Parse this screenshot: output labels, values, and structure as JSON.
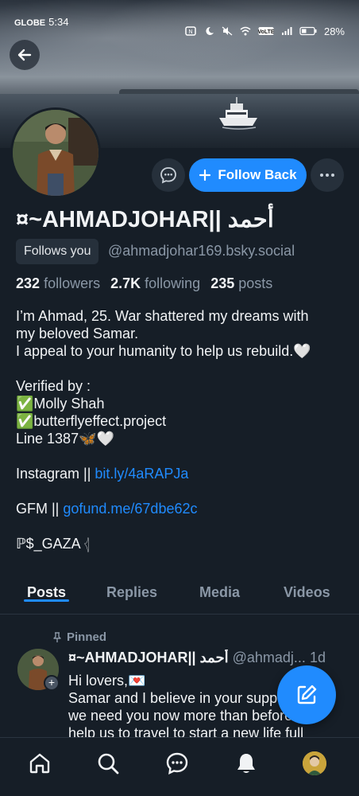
{
  "status_bar": {
    "carrier": "GLOBE",
    "time": "5:34",
    "battery": "28%",
    "icons": [
      "nfc-icon",
      "moon-icon",
      "mute-icon",
      "wifi-icon",
      "volte-icon",
      "signal-icon",
      "battery-icon"
    ]
  },
  "profile": {
    "display_name": "¤~AHMADJOHAR|| أحمد",
    "follows_you_label": "Follows you",
    "handle": "@ahmadjohar169.bsky.social",
    "stats": {
      "followers_count": "232",
      "followers_label": "followers",
      "following_count": "2.7K",
      "following_label": "following",
      "posts_count": "235",
      "posts_label": "posts"
    },
    "follow_button_label": "Follow Back"
  },
  "bio": {
    "line1": "I’m Ahmad, 25. War shattered my dreams with",
    "line2": "my beloved Samar.",
    "line3": "I appeal to your humanity to help us rebuild.🤍",
    "verified_title": "Verified by :",
    "verified_1": "✅Molly Shah",
    "verified_2": "✅butterflyeffect.project",
    "line_1387": "Line 1387🦋🤍",
    "instagram_prefix": "Instagram || ",
    "instagram_link": "bit.ly/4aRAPJa",
    "gfm_prefix": "GFM || ",
    "gfm_link": "gofund.me/67dbe62c",
    "tag": "ℙ$_GAZA 𓂆"
  },
  "tabs": [
    {
      "label": "Posts",
      "active": true
    },
    {
      "label": "Replies",
      "active": false
    },
    {
      "label": "Media",
      "active": false
    },
    {
      "label": "Videos",
      "active": false
    }
  ],
  "post": {
    "pinned_label": "Pinned",
    "author_name": "¤~AHMADJOHAR|| أحمد",
    "author_handle": "@ahmadj...",
    "time": "1d",
    "text_line1": "Hi lovers,💌",
    "text_line2": "Samar and I believe in your support,",
    "text_line3": "we need you now more than before to",
    "text_line4": "help us to travel to start a new life full"
  },
  "bottom_nav": [
    "home-icon",
    "search-icon",
    "chat-icon",
    "bell-icon",
    "profile-avatar"
  ],
  "colors": {
    "background": "#161e27",
    "accent": "#208bfe",
    "muted_text": "#8a97a6",
    "surface": "#26303b"
  }
}
